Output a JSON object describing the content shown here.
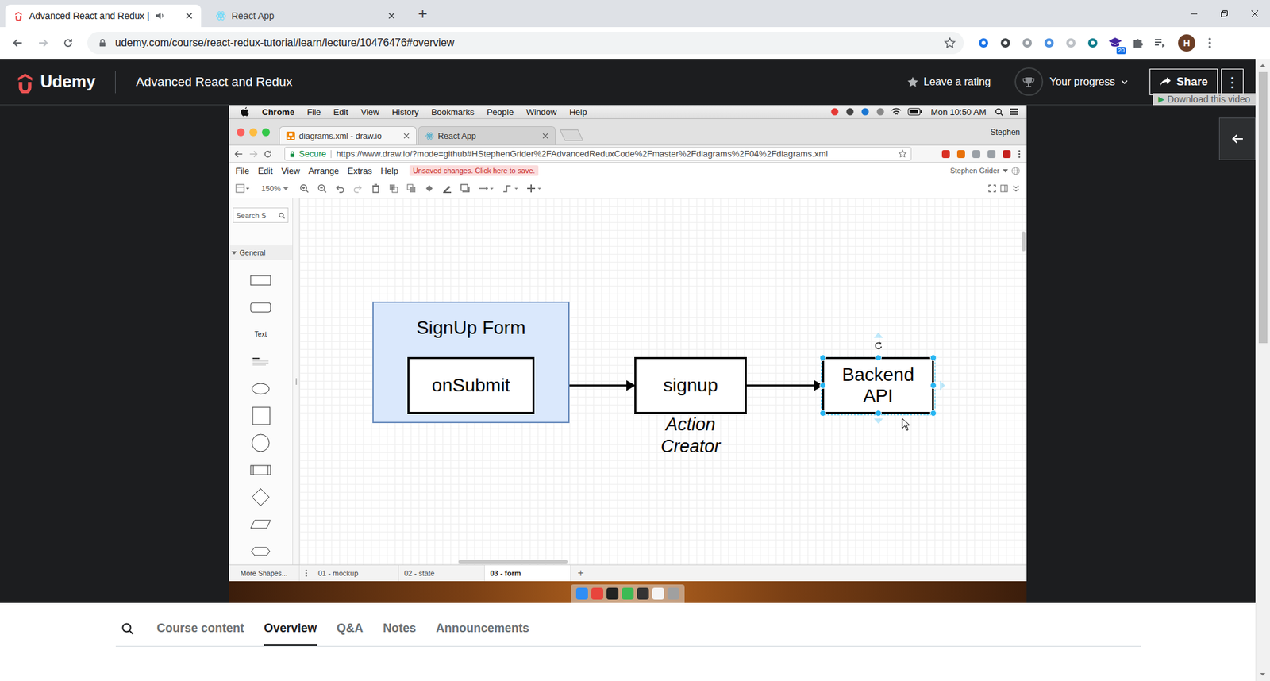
{
  "browser": {
    "tabs": [
      {
        "label": "Advanced React and Redux |",
        "selected": true
      },
      {
        "label": "React App",
        "selected": false
      }
    ],
    "new_tab": "+",
    "address": "udemy.com/course/react-redux-tutorial/learn/lecture/10476476#overview",
    "extension_badge": "20",
    "avatar": "H"
  },
  "header": {
    "logo": "Udemy",
    "course_title": "Advanced React and Redux",
    "rating": "Leave a rating",
    "progress": "Your progress",
    "share": "Share",
    "more": "⋮"
  },
  "download_overlay": {
    "icon": "▶",
    "label": "Download this video"
  },
  "video": {
    "menu_bar": {
      "app": "Chrome",
      "items": [
        "File",
        "Edit",
        "View",
        "History",
        "Bookmarks",
        "People",
        "Window",
        "Help"
      ],
      "clock": "Mon 10:50 AM"
    },
    "tabs": [
      {
        "label": "diagrams.xml - draw.io",
        "selected": true
      },
      {
        "label": "React App",
        "selected": false
      }
    ],
    "profile": "Stephen",
    "secure": "Secure",
    "url": "https://www.draw.io/?mode=github#HStephenGrider%2FAdvancedReduxCode%2Fmaster%2Fdiagrams%2F04%2Fdiagrams.xml",
    "app_menu": [
      "File",
      "Edit",
      "View",
      "Arrange",
      "Extras",
      "Help"
    ],
    "notice": "Unsaved changes. Click here to save.",
    "user": "Stephen Grider",
    "zoom": "150%",
    "sidebar": {
      "search_placeholder": "Search S",
      "section": "General",
      "text_shape": "Text",
      "more": "More Shapes..."
    },
    "pages": [
      {
        "label": "01 - mockup",
        "selected": false
      },
      {
        "label": "02 - state",
        "selected": false
      },
      {
        "label": "03 - form",
        "selected": true
      }
    ],
    "add_page": "+",
    "diagram": {
      "container": "SignUp Form",
      "nodes": [
        {
          "label": "onSubmit",
          "selected": false
        },
        {
          "label": "signup",
          "selected": false
        },
        {
          "label": "Backend API",
          "selected": true
        }
      ],
      "caption": "Action Creator"
    }
  },
  "course_tabs": [
    {
      "label": "Course content",
      "selected": false
    },
    {
      "label": "Overview",
      "selected": true
    },
    {
      "label": "Q&A",
      "selected": false
    },
    {
      "label": "Notes",
      "selected": false
    },
    {
      "label": "Announcements",
      "selected": false
    }
  ]
}
